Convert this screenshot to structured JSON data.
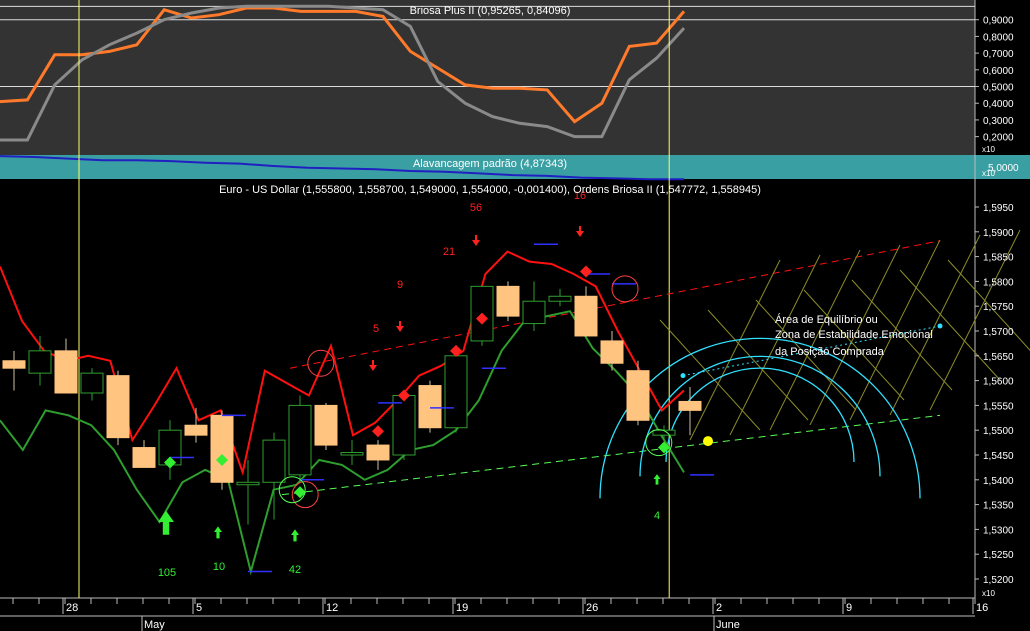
{
  "colors": {
    "background": "#000000",
    "indicator_bg": "#333333",
    "leverage_band": "#3a9fa3",
    "axis_text": "#ffffff",
    "bull_body": "#000000",
    "bull_outline": "#2f9e2f",
    "bear_body": "#ffc580",
    "red_line": "#ff1010",
    "green_line": "#2e9e2e",
    "orange_line": "#ff7a2a",
    "gray_line": "#8a8a8a",
    "blue_line": "#2020c0",
    "signal_red": "#ff2020",
    "signal_green": "#33ee33",
    "cyan": "#30e0ff",
    "yellow_vline": "#ffff66"
  },
  "labels": {
    "indicator_title": "Briosa Plus II (0,95265, 0,84096)",
    "leverage_title": "Alavancagem padrão (4,87343)",
    "leverage_value": "5,0000",
    "main_title": "Euro - US Dollar (1,555800, 1,558700, 1,549000, 1,554000, -0,001400), Ordens Briosa II (1,547772, 1,558945)",
    "annotation": [
      "Área de Equilíbrio ou",
      "Zona de Estabilidade Emocional",
      "da Posição Comprada"
    ],
    "x10_top": "x10",
    "x10_mid": "x10",
    "x10_bottom": "x10"
  },
  "chart_data": [
    {
      "type": "line",
      "title": "Briosa Plus II (0,95265, 0,84096)",
      "y_ticks": [
        "0,9000",
        "0,8000",
        "0,7000",
        "0,6000",
        "0,5000",
        "0,4000",
        "0,3000",
        "0,2000"
      ],
      "ylim": [
        0.12,
        1.0
      ],
      "reference_lines": [
        0.98,
        0.9,
        0.5
      ],
      "grid": false,
      "series": [
        {
          "color": "orange",
          "values": [
            0.41,
            0.42,
            0.69,
            0.69,
            0.71,
            0.75,
            0.96,
            0.91,
            0.93,
            0.97,
            0.97,
            0.95,
            0.95,
            0.95,
            0.92,
            0.71,
            0.61,
            0.51,
            0.49,
            0.49,
            0.48,
            0.29,
            0.4,
            0.74,
            0.76,
            0.95
          ]
        },
        {
          "color": "gray",
          "values": [
            0.18,
            0.18,
            0.51,
            0.66,
            0.75,
            0.82,
            0.9,
            0.94,
            0.97,
            0.98,
            0.98,
            0.98,
            0.98,
            0.97,
            0.96,
            0.86,
            0.53,
            0.4,
            0.32,
            0.28,
            0.26,
            0.2,
            0.2,
            0.54,
            0.67,
            0.85
          ]
        }
      ]
    },
    {
      "type": "line",
      "title": "Alavancagem padrão (4,87343)",
      "y_ticks": [
        "5,0000"
      ],
      "ylim": [
        4.8,
        5.2
      ],
      "series": [
        {
          "color": "blue",
          "values": [
            5.15,
            5.14,
            5.12,
            5.1,
            5.1,
            5.09,
            5.07,
            5.06,
            5.03,
            5.01,
            5.0,
            4.99,
            4.97,
            4.96,
            4.94,
            4.92,
            4.91,
            4.89,
            4.88,
            4.87,
            4.87
          ]
        }
      ]
    },
    {
      "type": "candlestick",
      "title": "Euro - US Dollar (1,555800, 1,558700, 1,549000, 1,554000, -0,001400), Ordens Briosa II (1,547772, 1,558945)",
      "ylim": [
        1.518,
        1.605
      ],
      "y_ticks": [
        "1,5950",
        "1,5900",
        "1,5850",
        "1,5800",
        "1,5750",
        "1,5700",
        "1,5650",
        "1,5600",
        "1,5550",
        "1,5500",
        "1,5450",
        "1,5400",
        "1,5350",
        "1,5300",
        "1,5250",
        "1,5200"
      ],
      "x_ticks": [
        {
          "i": 2,
          "label": "28"
        },
        {
          "i": 7,
          "label": "5"
        },
        {
          "i": 12,
          "label": "12"
        },
        {
          "i": 17,
          "label": "19"
        },
        {
          "i": 22,
          "label": "26"
        },
        {
          "i": 27,
          "label": "2"
        },
        {
          "i": 32,
          "label": "9"
        },
        {
          "i": 37,
          "label": "16"
        }
      ],
      "months": [
        {
          "i": 5,
          "label": "May"
        },
        {
          "i": 27,
          "label": "June"
        }
      ],
      "vlines": [
        2.5,
        25.2
      ],
      "candles": [
        {
          "o": 1.564,
          "h": 1.566,
          "l": 1.558,
          "c": 1.5625
        },
        {
          "o": 1.5615,
          "h": 1.569,
          "l": 1.559,
          "c": 1.566
        },
        {
          "o": 1.566,
          "h": 1.5685,
          "l": 1.56,
          "c": 1.5575
        },
        {
          "o": 1.5575,
          "h": 1.5625,
          "l": 1.556,
          "c": 1.5615
        },
        {
          "o": 1.561,
          "h": 1.562,
          "l": 1.547,
          "c": 1.5485
        },
        {
          "o": 1.5465,
          "h": 1.548,
          "l": 1.5425,
          "c": 1.5425
        },
        {
          "o": 1.543,
          "h": 1.552,
          "l": 1.54,
          "c": 1.55
        },
        {
          "o": 1.551,
          "h": 1.5545,
          "l": 1.5475,
          "c": 1.549
        },
        {
          "o": 1.553,
          "h": 1.554,
          "l": 1.538,
          "c": 1.5395
        },
        {
          "o": 1.539,
          "h": 1.544,
          "l": 1.531,
          "c": 1.5395
        },
        {
          "o": 1.5395,
          "h": 1.5495,
          "l": 1.532,
          "c": 1.548
        },
        {
          "o": 1.541,
          "h": 1.557,
          "l": 1.54,
          "c": 1.555
        },
        {
          "o": 1.555,
          "h": 1.5555,
          "l": 1.546,
          "c": 1.547
        },
        {
          "o": 1.545,
          "h": 1.548,
          "l": 1.543,
          "c": 1.5455
        },
        {
          "o": 1.547,
          "h": 1.548,
          "l": 1.542,
          "c": 1.544
        },
        {
          "o": 1.545,
          "h": 1.558,
          "l": 1.544,
          "c": 1.557
        },
        {
          "o": 1.559,
          "h": 1.56,
          "l": 1.5495,
          "c": 1.5505
        },
        {
          "o": 1.5505,
          "h": 1.566,
          "l": 1.5495,
          "c": 1.565
        },
        {
          "o": 1.568,
          "h": 1.579,
          "l": 1.567,
          "c": 1.579
        },
        {
          "o": 1.579,
          "h": 1.58,
          "l": 1.572,
          "c": 1.573
        },
        {
          "o": 1.5715,
          "h": 1.58,
          "l": 1.57,
          "c": 1.576
        },
        {
          "o": 1.576,
          "h": 1.5785,
          "l": 1.575,
          "c": 1.577
        },
        {
          "o": 1.577,
          "h": 1.579,
          "l": 1.569,
          "c": 1.569
        },
        {
          "o": 1.568,
          "h": 1.57,
          "l": 1.562,
          "c": 1.5635
        },
        {
          "o": 1.562,
          "h": 1.564,
          "l": 1.551,
          "c": 1.552
        },
        {
          "o": 1.549,
          "h": 1.551,
          "l": 1.548,
          "c": 1.55
        },
        {
          "o": 1.5558,
          "h": 1.5587,
          "l": 1.549,
          "c": 1.554
        }
      ],
      "red_line": [
        1.583,
        1.572,
        1.566,
        1.564,
        1.565,
        1.564,
        1.548,
        1.555,
        1.5625,
        1.552,
        1.554,
        1.5415,
        1.562,
        1.5595,
        1.557,
        1.567,
        1.549,
        1.5515,
        1.556,
        1.561,
        1.563,
        1.566,
        1.5815,
        1.586,
        1.584,
        1.5835,
        1.5815,
        1.579,
        1.57,
        1.562,
        1.554,
        1.558
      ],
      "green_line": [
        1.552,
        1.546,
        1.554,
        1.553,
        1.551,
        1.546,
        1.538,
        1.5315,
        1.5395,
        1.542,
        1.54,
        1.5215,
        1.538,
        1.539,
        1.544,
        1.543,
        1.54,
        1.542,
        1.546,
        1.547,
        1.55,
        1.556,
        1.566,
        1.572,
        1.573,
        1.574,
        1.5665,
        1.562,
        1.557,
        1.549,
        1.5415
      ],
      "signals": [
        {
          "type": "sell",
          "label": "9",
          "marker": false,
          "i": 15
        },
        {
          "type": "sell",
          "label": "5",
          "marker": false,
          "i": 14
        },
        {
          "type": "sell",
          "label": "21",
          "marker": false,
          "i": 18
        },
        {
          "type": "sell",
          "label": "56",
          "marker": false,
          "i": 18
        },
        {
          "type": "sell",
          "label": "16",
          "marker": false,
          "i": 22
        },
        {
          "type": "buy",
          "label": "105",
          "i": 6
        },
        {
          "type": "buy",
          "label": "10",
          "i": 8
        },
        {
          "type": "buy",
          "label": "42",
          "i": 11
        },
        {
          "type": "buy",
          "label": "4",
          "i": 25
        }
      ]
    }
  ]
}
